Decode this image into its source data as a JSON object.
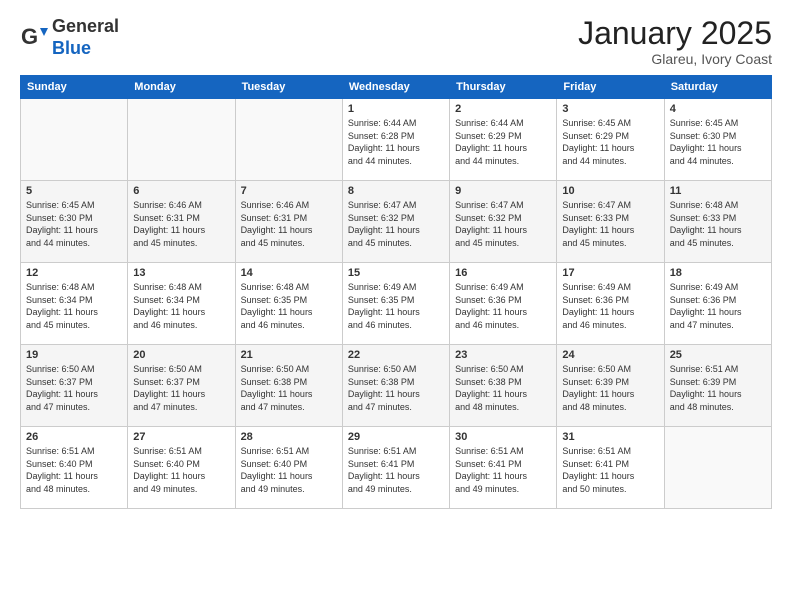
{
  "logo": {
    "general": "General",
    "blue": "Blue"
  },
  "header": {
    "month": "January 2025",
    "location": "Glareu, Ivory Coast"
  },
  "weekdays": [
    "Sunday",
    "Monday",
    "Tuesday",
    "Wednesday",
    "Thursday",
    "Friday",
    "Saturday"
  ],
  "weeks": [
    [
      {
        "day": "",
        "info": ""
      },
      {
        "day": "",
        "info": ""
      },
      {
        "day": "",
        "info": ""
      },
      {
        "day": "1",
        "info": "Sunrise: 6:44 AM\nSunset: 6:28 PM\nDaylight: 11 hours\nand 44 minutes."
      },
      {
        "day": "2",
        "info": "Sunrise: 6:44 AM\nSunset: 6:29 PM\nDaylight: 11 hours\nand 44 minutes."
      },
      {
        "day": "3",
        "info": "Sunrise: 6:45 AM\nSunset: 6:29 PM\nDaylight: 11 hours\nand 44 minutes."
      },
      {
        "day": "4",
        "info": "Sunrise: 6:45 AM\nSunset: 6:30 PM\nDaylight: 11 hours\nand 44 minutes."
      }
    ],
    [
      {
        "day": "5",
        "info": "Sunrise: 6:45 AM\nSunset: 6:30 PM\nDaylight: 11 hours\nand 44 minutes."
      },
      {
        "day": "6",
        "info": "Sunrise: 6:46 AM\nSunset: 6:31 PM\nDaylight: 11 hours\nand 45 minutes."
      },
      {
        "day": "7",
        "info": "Sunrise: 6:46 AM\nSunset: 6:31 PM\nDaylight: 11 hours\nand 45 minutes."
      },
      {
        "day": "8",
        "info": "Sunrise: 6:47 AM\nSunset: 6:32 PM\nDaylight: 11 hours\nand 45 minutes."
      },
      {
        "day": "9",
        "info": "Sunrise: 6:47 AM\nSunset: 6:32 PM\nDaylight: 11 hours\nand 45 minutes."
      },
      {
        "day": "10",
        "info": "Sunrise: 6:47 AM\nSunset: 6:33 PM\nDaylight: 11 hours\nand 45 minutes."
      },
      {
        "day": "11",
        "info": "Sunrise: 6:48 AM\nSunset: 6:33 PM\nDaylight: 11 hours\nand 45 minutes."
      }
    ],
    [
      {
        "day": "12",
        "info": "Sunrise: 6:48 AM\nSunset: 6:34 PM\nDaylight: 11 hours\nand 45 minutes."
      },
      {
        "day": "13",
        "info": "Sunrise: 6:48 AM\nSunset: 6:34 PM\nDaylight: 11 hours\nand 46 minutes."
      },
      {
        "day": "14",
        "info": "Sunrise: 6:48 AM\nSunset: 6:35 PM\nDaylight: 11 hours\nand 46 minutes."
      },
      {
        "day": "15",
        "info": "Sunrise: 6:49 AM\nSunset: 6:35 PM\nDaylight: 11 hours\nand 46 minutes."
      },
      {
        "day": "16",
        "info": "Sunrise: 6:49 AM\nSunset: 6:36 PM\nDaylight: 11 hours\nand 46 minutes."
      },
      {
        "day": "17",
        "info": "Sunrise: 6:49 AM\nSunset: 6:36 PM\nDaylight: 11 hours\nand 46 minutes."
      },
      {
        "day": "18",
        "info": "Sunrise: 6:49 AM\nSunset: 6:36 PM\nDaylight: 11 hours\nand 47 minutes."
      }
    ],
    [
      {
        "day": "19",
        "info": "Sunrise: 6:50 AM\nSunset: 6:37 PM\nDaylight: 11 hours\nand 47 minutes."
      },
      {
        "day": "20",
        "info": "Sunrise: 6:50 AM\nSunset: 6:37 PM\nDaylight: 11 hours\nand 47 minutes."
      },
      {
        "day": "21",
        "info": "Sunrise: 6:50 AM\nSunset: 6:38 PM\nDaylight: 11 hours\nand 47 minutes."
      },
      {
        "day": "22",
        "info": "Sunrise: 6:50 AM\nSunset: 6:38 PM\nDaylight: 11 hours\nand 47 minutes."
      },
      {
        "day": "23",
        "info": "Sunrise: 6:50 AM\nSunset: 6:38 PM\nDaylight: 11 hours\nand 48 minutes."
      },
      {
        "day": "24",
        "info": "Sunrise: 6:50 AM\nSunset: 6:39 PM\nDaylight: 11 hours\nand 48 minutes."
      },
      {
        "day": "25",
        "info": "Sunrise: 6:51 AM\nSunset: 6:39 PM\nDaylight: 11 hours\nand 48 minutes."
      }
    ],
    [
      {
        "day": "26",
        "info": "Sunrise: 6:51 AM\nSunset: 6:40 PM\nDaylight: 11 hours\nand 48 minutes."
      },
      {
        "day": "27",
        "info": "Sunrise: 6:51 AM\nSunset: 6:40 PM\nDaylight: 11 hours\nand 49 minutes."
      },
      {
        "day": "28",
        "info": "Sunrise: 6:51 AM\nSunset: 6:40 PM\nDaylight: 11 hours\nand 49 minutes."
      },
      {
        "day": "29",
        "info": "Sunrise: 6:51 AM\nSunset: 6:41 PM\nDaylight: 11 hours\nand 49 minutes."
      },
      {
        "day": "30",
        "info": "Sunrise: 6:51 AM\nSunset: 6:41 PM\nDaylight: 11 hours\nand 49 minutes."
      },
      {
        "day": "31",
        "info": "Sunrise: 6:51 AM\nSunset: 6:41 PM\nDaylight: 11 hours\nand 50 minutes."
      },
      {
        "day": "",
        "info": ""
      }
    ]
  ]
}
